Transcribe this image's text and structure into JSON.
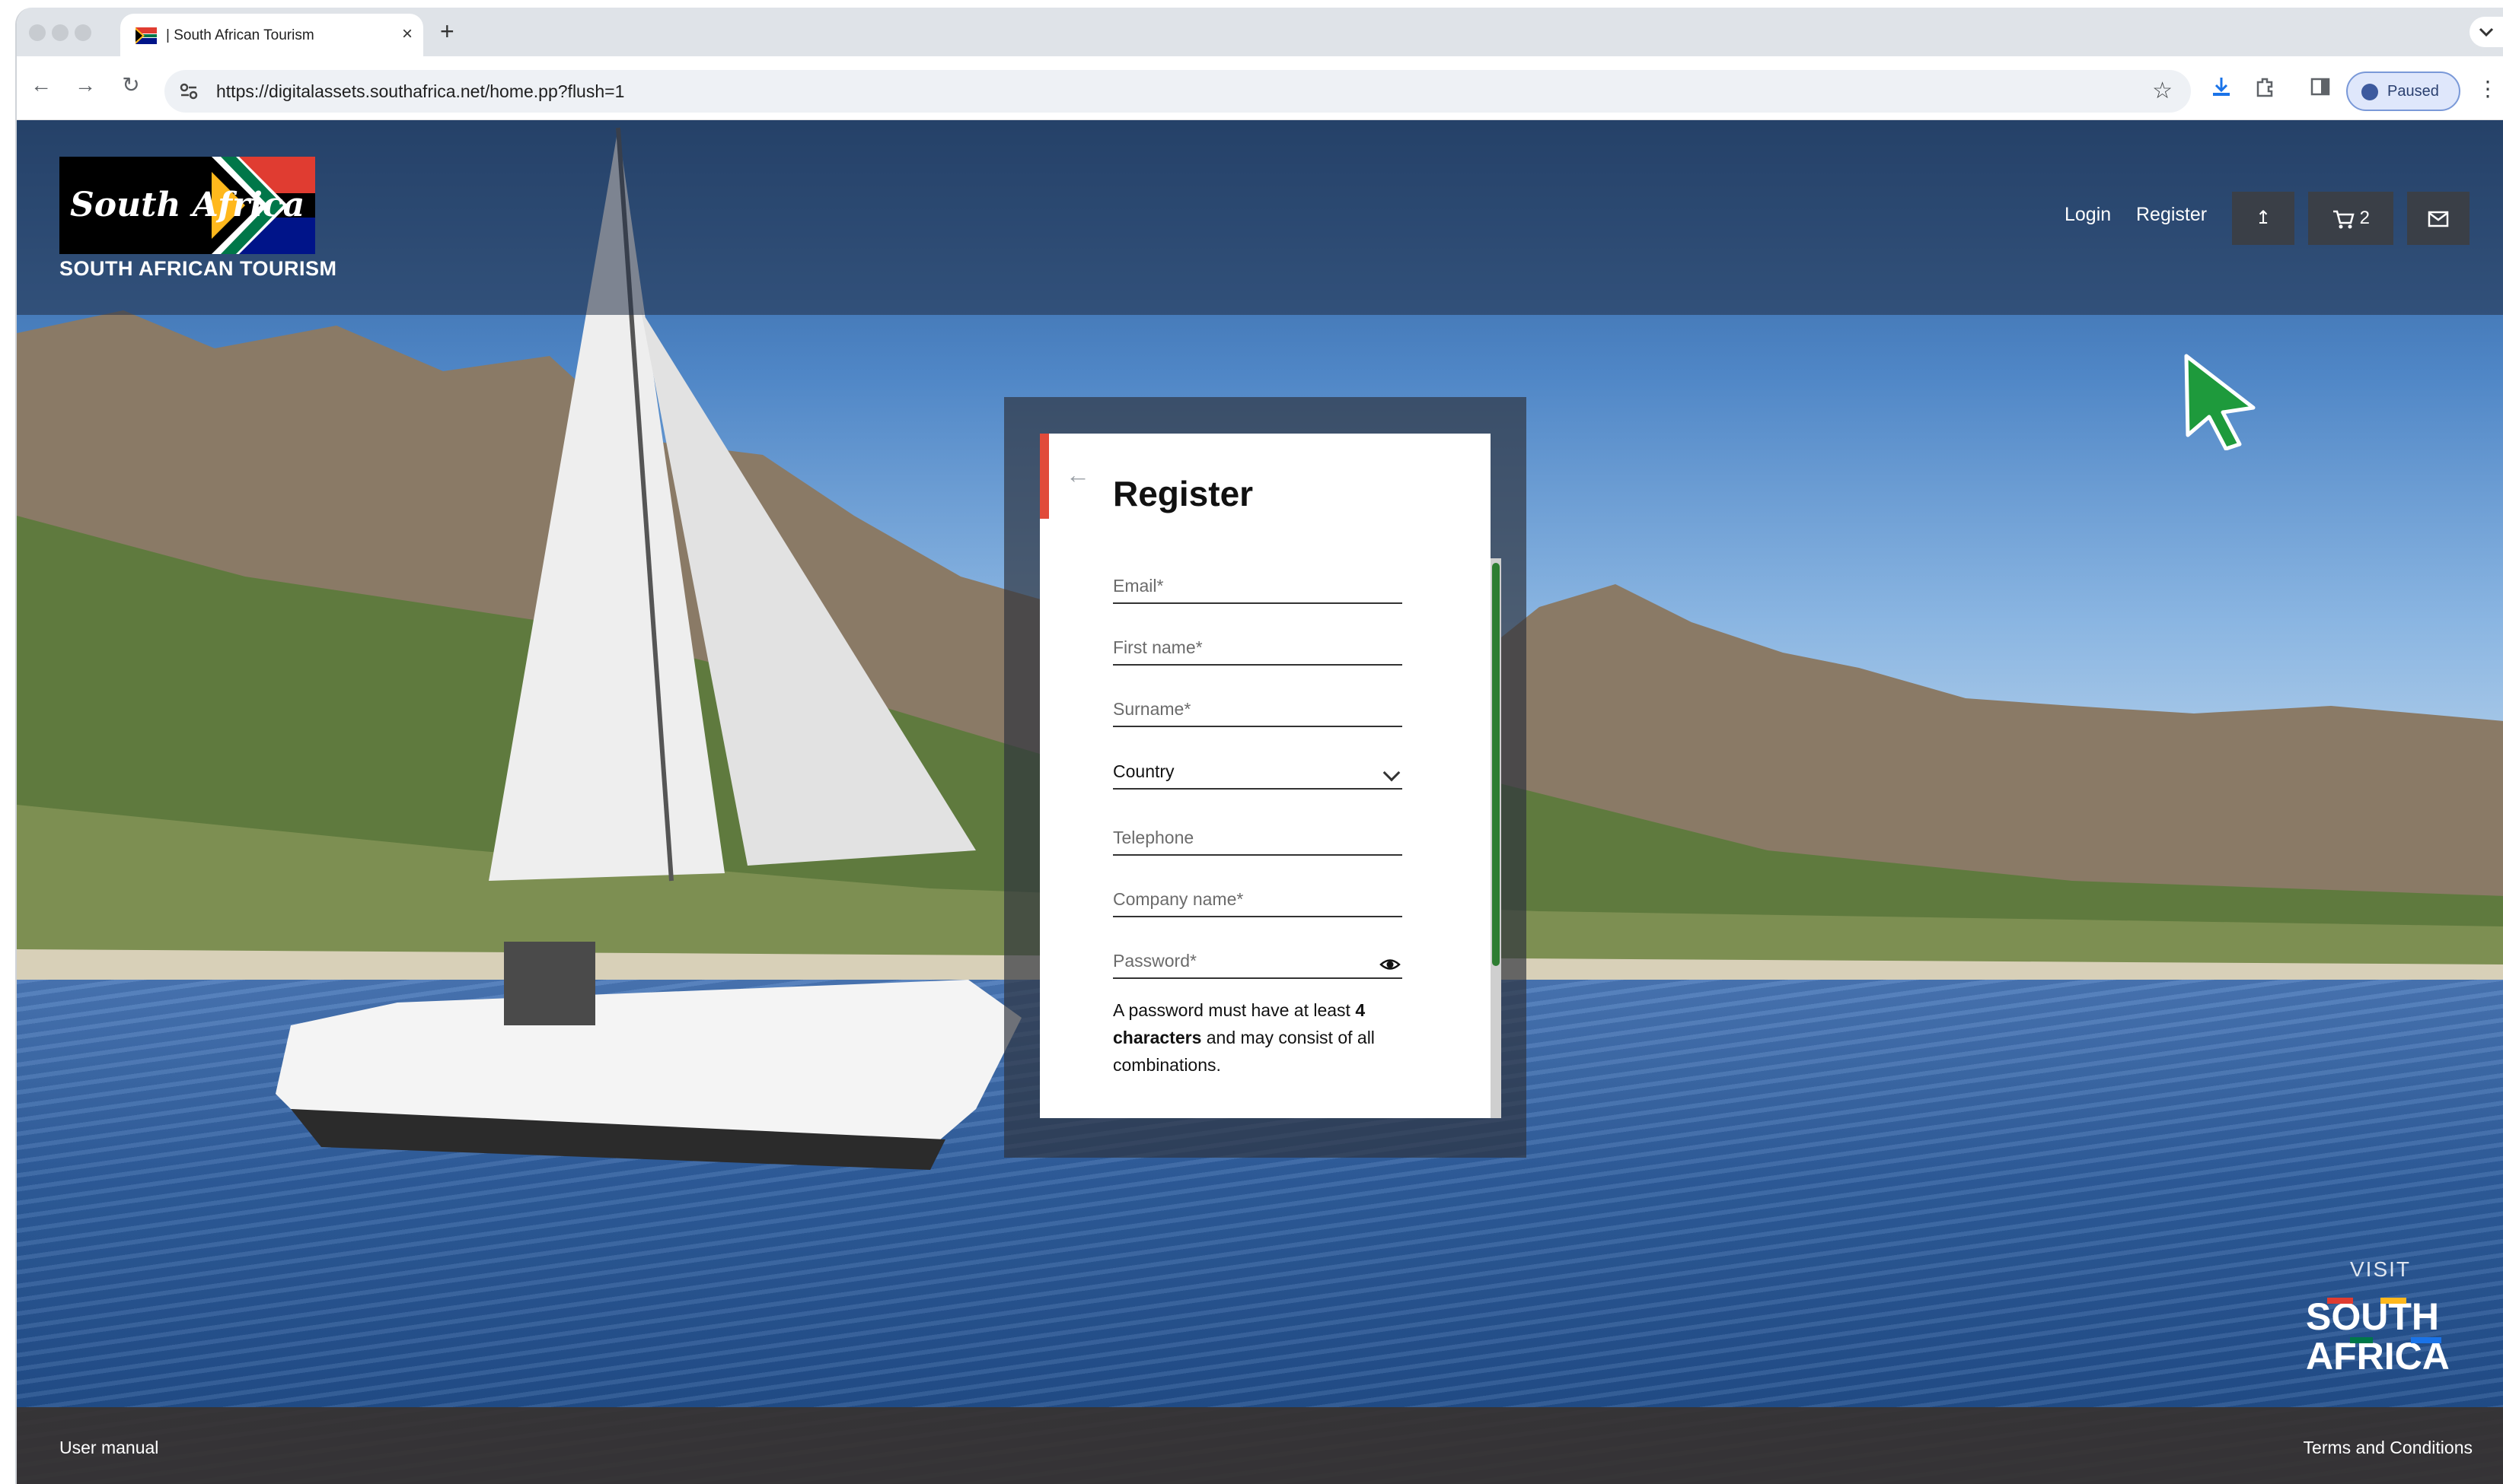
{
  "browser": {
    "tab_title": "| South African Tourism",
    "tab_close": "×",
    "new_tab": "+",
    "url": "https://digitalassets.southafrica.net/home.pp?flush=1",
    "profile_label": "Paused",
    "nav_back": "←",
    "nav_forward": "→",
    "nav_reload": "↻",
    "star": "☆",
    "menu": "⋮"
  },
  "header": {
    "logo_text": "South Africa",
    "logo_caption": "SOUTH AFRICAN TOURISM",
    "login_label": "Login",
    "register_label": "Register",
    "upload_icon_glyph": "↥",
    "cart_icon_glyph": "🛒",
    "cart_count": "2",
    "mail_icon_glyph": "✉"
  },
  "form": {
    "back_glyph": "←",
    "title": "Register",
    "email_label": "Email*",
    "first_name_label": "First name*",
    "surname_label": "Surname*",
    "country_label": "Country",
    "telephone_label": "Telephone",
    "company_label": "Company name*",
    "password_label": "Password*",
    "hint_part1": "A password must have at least ",
    "hint_bold": "4 characters",
    "hint_part2": " and may consist of all combinations."
  },
  "badge": {
    "visit_word": "VISIT",
    "brand_line1": "SOUTH",
    "brand_line2": "AFRICA"
  },
  "footer": {
    "left_link": "User manual",
    "right_link": "Terms and Conditions"
  },
  "colors": {
    "accent_red": "#e14b3a",
    "scroll_green": "#2e7d32",
    "cursor_green": "#1e9a3c"
  }
}
